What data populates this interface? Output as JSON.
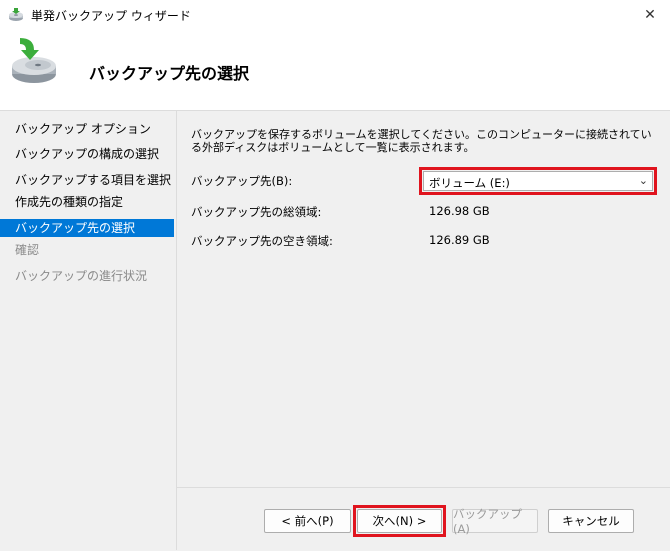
{
  "window": {
    "title": "単発バックアップ ウィザード",
    "close_glyph": "✕"
  },
  "header": {
    "title": "バックアップ先の選択"
  },
  "sidebar": {
    "items": [
      {
        "label": "バックアップ オプション"
      },
      {
        "label": "バックアップの構成の選択"
      },
      {
        "label": "バックアップする項目を選択"
      },
      {
        "label": "作成先の種類の指定"
      },
      {
        "label": "バックアップ先の選択"
      },
      {
        "label": "確認"
      },
      {
        "label": "バックアップの進行状況"
      }
    ]
  },
  "main": {
    "description": "バックアップを保存するボリュームを選択してください。このコンピューターに接続されている外部ディスクはボリュームとして一覧に表示されます。",
    "destination_label": "バックアップ先(B):",
    "destination_value": "ボリューム (E:)",
    "total_label": "バックアップ先の総領域:",
    "total_value": "126.98 GB",
    "free_label": "バックアップ先の空き領域:",
    "free_value": "126.89 GB"
  },
  "buttons": {
    "back": "< 前へ(P)",
    "next": "次へ(N) >",
    "backup": "バックアップ(A)",
    "cancel": "キャンセル"
  },
  "colors": {
    "accent": "#0078d7",
    "highlight": "#e0141e"
  }
}
